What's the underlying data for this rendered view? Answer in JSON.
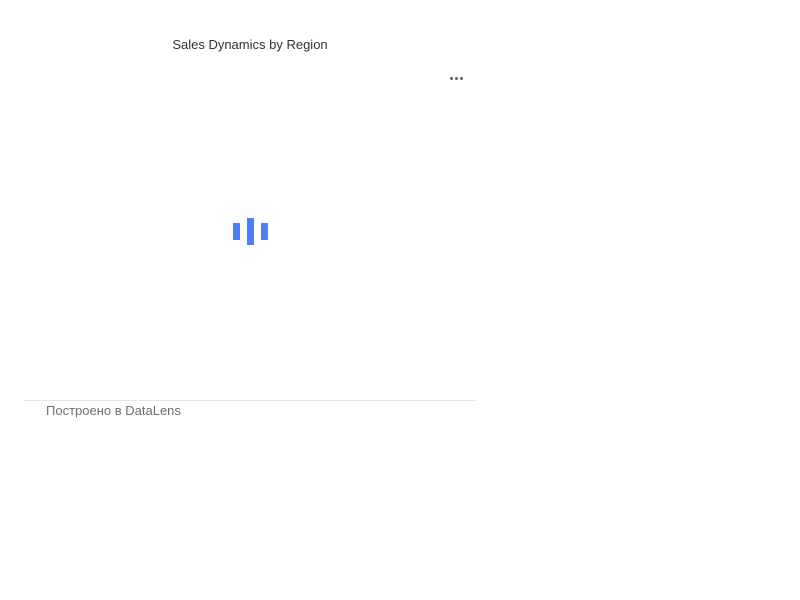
{
  "widget": {
    "title": "Sales Dynamics by Region",
    "menu_icon": "more-horizontal-icon",
    "loading": true,
    "loader_icon": "loading-bars-icon",
    "accent_color": "#4d7ff7"
  },
  "footer": {
    "credit": "Построено в DataLens"
  }
}
